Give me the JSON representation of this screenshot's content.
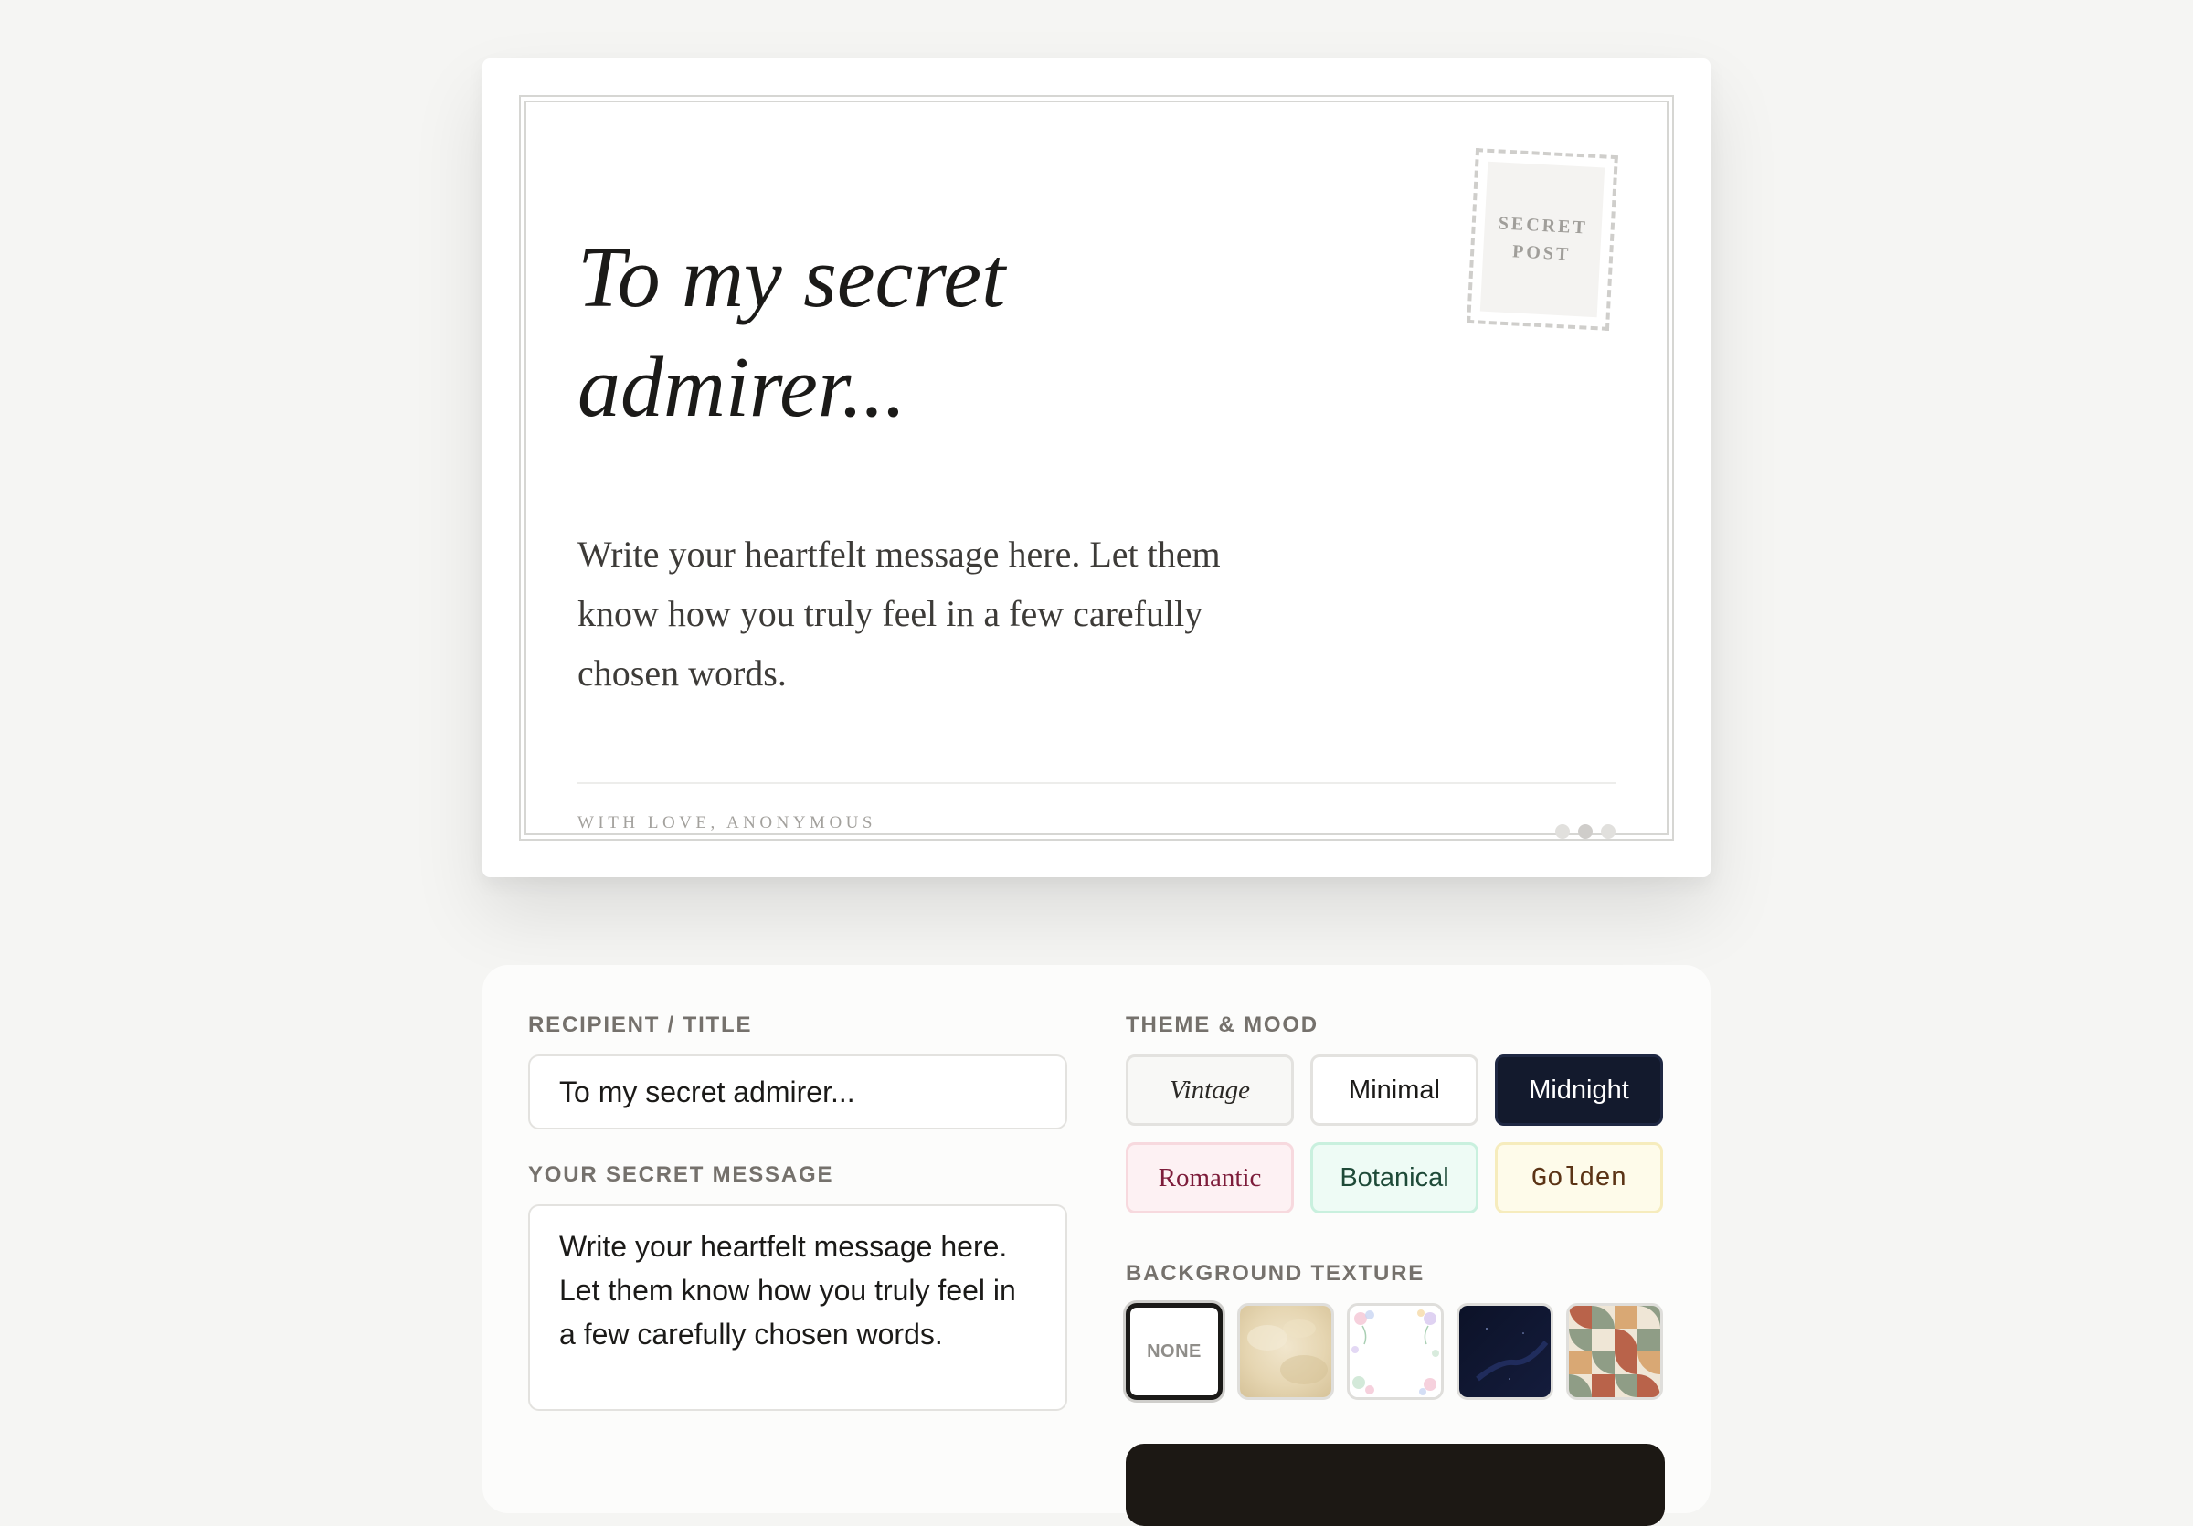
{
  "postcard": {
    "title": "To my secret admirer...",
    "message": "Write your heartfelt message here. Let them know how you truly feel in a few carefully chosen words.",
    "signature": "WITH LOVE, ANONYMOUS",
    "stamp_line1": "SECRET",
    "stamp_line2": "POST"
  },
  "editor": {
    "recipient_label": "RECIPIENT / TITLE",
    "recipient_value": "To my secret admirer...",
    "message_label": "YOUR SECRET MESSAGE",
    "message_value": "Write your heartfelt message here. Let them know how you truly feel in a few carefully chosen words.",
    "theme_label": "THEME & MOOD",
    "themes": [
      "Vintage",
      "Minimal",
      "Midnight",
      "Romantic",
      "Botanical",
      "Golden"
    ],
    "selected_theme": "Midnight",
    "texture_label": "BACKGROUND TEXTURE",
    "textures": [
      {
        "label": "NONE",
        "icon": "none-texture"
      },
      {
        "icon": "parchment-texture"
      },
      {
        "icon": "floral-texture"
      },
      {
        "icon": "night-sky-texture"
      },
      {
        "icon": "geometric-texture"
      }
    ],
    "selected_texture": "NONE"
  },
  "colors": {
    "page_background": "#f5f5f3",
    "midnight": "#131a2d",
    "romantic_text": "#7d1c3a",
    "botanical_text": "#1e4a38",
    "golden_text": "#5b3315",
    "primary_button": "#1c1814"
  }
}
